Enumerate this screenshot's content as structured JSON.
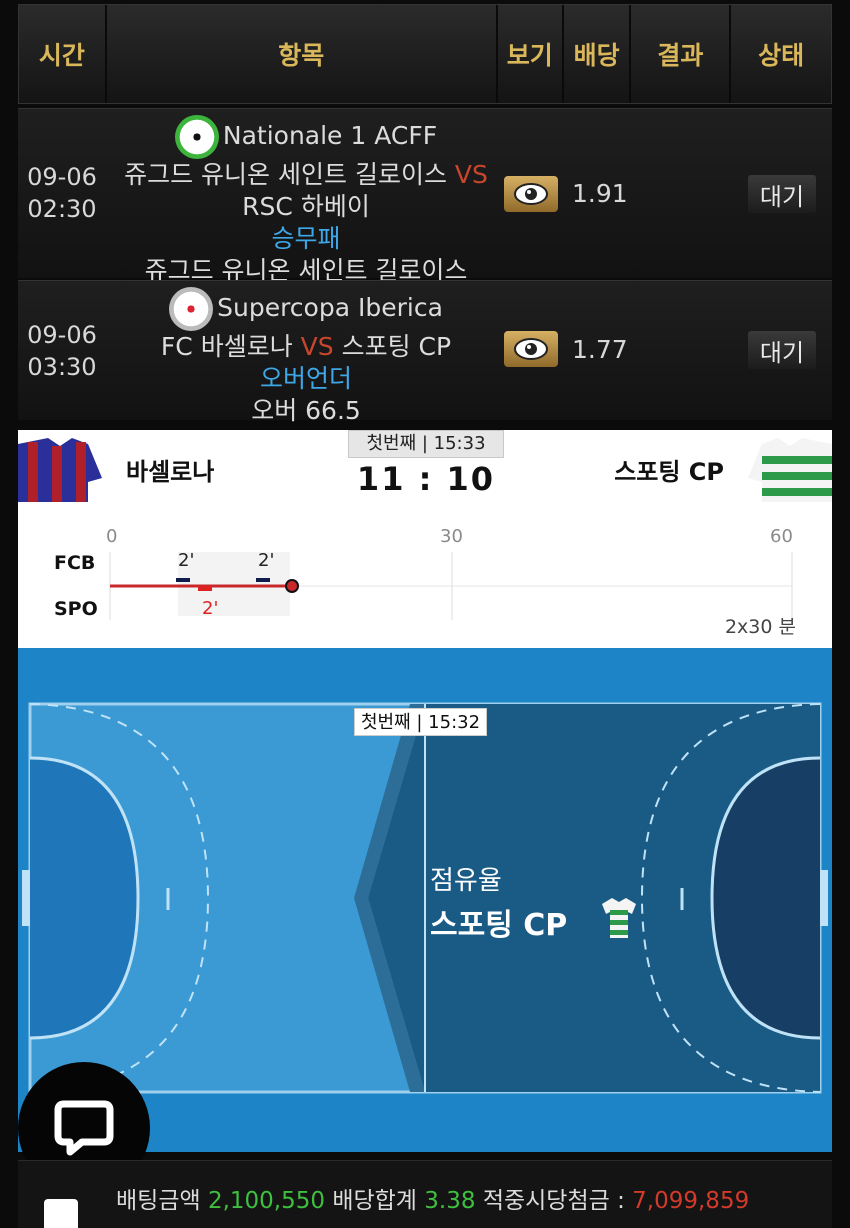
{
  "header": {
    "time": "시간",
    "item": "항목",
    "view": "보기",
    "odds": "배당",
    "result": "결과",
    "status": "상태"
  },
  "rows": [
    {
      "date": "09-06",
      "time": "02:30",
      "league": "Nationale 1 ACFF",
      "league_icon": "soccer-ball-icon",
      "home": "쥬그드 유니온 세인트 길로이스",
      "vs": "VS",
      "away": "RSC 하베이",
      "market": "승무패",
      "selection": "쥬그드 유니온 세인트 길로이스",
      "odds": "1.91",
      "status": "대기"
    },
    {
      "date": "09-06",
      "time": "03:30",
      "league": "Supercopa Iberica",
      "league_icon": "handball-icon",
      "home": "FC 바셀로나",
      "vs": "VS",
      "away": "스포팅 CP",
      "market": "오버언더",
      "selection": "오버 66.5",
      "odds": "1.77",
      "status": "대기"
    }
  ],
  "live": {
    "period_top": "첫번째 | 15:33",
    "home_name": "바셀로나",
    "away_name": "스포팅 CP",
    "score": "11 : 10",
    "timeline": {
      "ticks": [
        "0",
        "30",
        "60"
      ],
      "home_abbr": "FCB",
      "away_abbr": "SPO",
      "home_penalties": [
        "2'",
        "2'"
      ],
      "away_penalties": [
        "2'"
      ],
      "current_minute_fraction": 0.3,
      "duration": "2x30 분"
    },
    "court": {
      "period": "첫번째 | 15:32",
      "possession_title": "점유율",
      "possession_team": "스포팅 CP"
    }
  },
  "bet": {
    "amount_label": "배팅금액",
    "amount": "2,100,550",
    "odds_label": "배당합계",
    "odds": "3.38",
    "payout_label": "적중시당첨금 :",
    "payout": "7,099,859"
  },
  "colors": {
    "header_text": "#d9b75a",
    "vs": "#c8462b",
    "pick": "#3ea7e8",
    "court": "#1c84c7",
    "green_value": "#3fbf3f",
    "red_value": "#d23a2a"
  }
}
